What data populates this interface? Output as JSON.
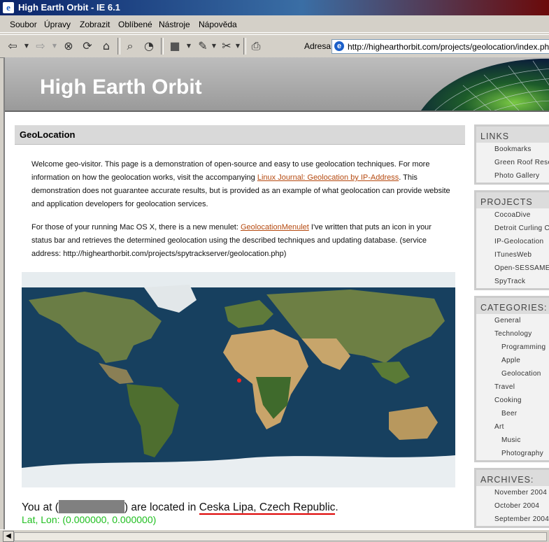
{
  "window": {
    "title": "High Earth Orbit - IE 6.1"
  },
  "menu": [
    "Soubor",
    "Úpravy",
    "Zobrazit",
    "Oblíbené",
    "Nástroje",
    "Nápověda"
  ],
  "address": {
    "label": "Adresa",
    "url": "http://highearthorbit.com/projects/geolocation/index.php"
  },
  "site": {
    "title": "High Earth Orbit"
  },
  "section": {
    "heading": "GeoLocation",
    "para1_a": "Welcome geo-visitor. This page is a demonstration of open-source and easy to use geolocation techniques. For more information on how the geolocation works, visit the accompanying ",
    "para1_link": "Linux Journal: Geolocation by IP-Address",
    "para1_b": ". This demonstration does not guarantee accurate results, but is provided as an example of what geolocation can provide website and application developers for geolocation services.",
    "para2_a": "For those of your running Mac OS X, there is a new menulet: ",
    "para2_link": "GeolocationMenulet",
    "para2_b": " I've written that puts an icon in your status bar and retrieves the determined geolocation using the described techniques and updating database. (service address: http://highearthorbit.com/projects/spytrackserver/geolocation.php)"
  },
  "result": {
    "you_prefix": "You at (",
    "you_mid": ") are located in ",
    "city": "Ceska Lipa, Czech Republic",
    "you_suffix": ".",
    "latlon": "Lat, Lon: (0.000000, 0.000000)"
  },
  "sidebar": {
    "links": {
      "heading": "LINKS",
      "items": [
        "Bookmarks",
        "Green Roof Reso",
        "Photo Gallery"
      ]
    },
    "projects": {
      "heading": "PROJECTS",
      "items": [
        "CocoaDive",
        "Detroit Curling Cl",
        "IP-Geolocation",
        "ITunesWeb",
        "Open-SESSAME",
        "SpyTrack"
      ]
    },
    "categories": {
      "heading": "CATEGORIES:",
      "items": [
        "General",
        "Technology",
        "Programming",
        "Apple",
        "Geolocation",
        "Travel",
        "Cooking",
        "Beer",
        "Art",
        "Music",
        "Photography"
      ]
    },
    "archives": {
      "heading": "ARCHIVES:",
      "items": [
        "November 2004",
        "October 2004",
        "September 2004"
      ]
    }
  }
}
